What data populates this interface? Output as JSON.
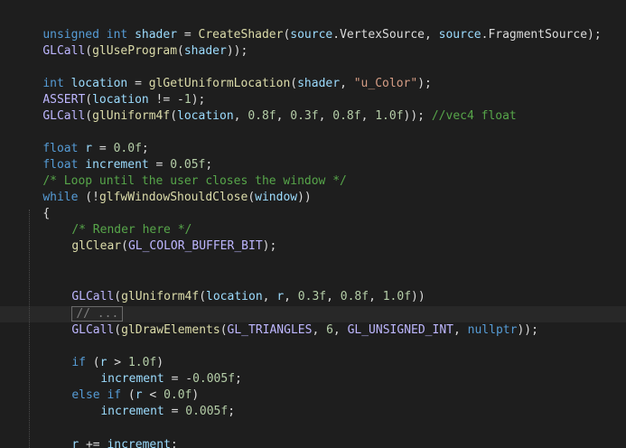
{
  "code": {
    "line1": {
      "t1": "unsigned",
      "t2": " ",
      "t3": "int",
      "t4": " ",
      "t5": "shader",
      "t6": " = ",
      "t7": "CreateShader",
      "t8": "(",
      "t9": "source",
      "t10": ".",
      "t11": "VertexSource",
      "t12": ", ",
      "t13": "source",
      "t14": ".",
      "t15": "FragmentSource",
      "t16": ");"
    },
    "line2": {
      "t1": "GLCall",
      "t2": "(",
      "t3": "glUseProgram",
      "t4": "(",
      "t5": "shader",
      "t6": "));"
    },
    "line4": {
      "t1": "int",
      "t2": " ",
      "t3": "location",
      "t4": " = ",
      "t5": "glGetUniformLocation",
      "t6": "(",
      "t7": "shader",
      "t8": ", ",
      "t9": "\"u_Color\"",
      "t10": ");"
    },
    "line5": {
      "t1": "ASSERT",
      "t2": "(",
      "t3": "location",
      "t4": " != -",
      "t5": "1",
      "t6": ");"
    },
    "line6": {
      "t1": "GLCall",
      "t2": "(",
      "t3": "glUniform4f",
      "t4": "(",
      "t5": "location",
      "t6": ", ",
      "t7": "0.8f",
      "t8": ", ",
      "t9": "0.3f",
      "t10": ", ",
      "t11": "0.8f",
      "t12": ", ",
      "t13": "1.0f",
      "t14": ")); ",
      "t15": "//vec4 float"
    },
    "line8": {
      "t1": "float",
      "t2": " ",
      "t3": "r",
      "t4": " = ",
      "t5": "0.0f",
      "t6": ";"
    },
    "line9": {
      "t1": "float",
      "t2": " ",
      "t3": "increment",
      "t4": " = ",
      "t5": "0.05f",
      "t6": ";"
    },
    "line10": {
      "t1": "/* Loop until the user closes the window */"
    },
    "line11": {
      "t1": "while",
      "t2": " (!",
      "t3": "glfwWindowShouldClose",
      "t4": "(",
      "t5": "window",
      "t6": "))"
    },
    "line12": {
      "t1": "{"
    },
    "line13": {
      "t1": "/* Render here */"
    },
    "line14": {
      "t1": "glClear",
      "t2": "(",
      "t3": "GL_COLOR_BUFFER_BIT",
      "t4": ");"
    },
    "line17": {
      "t1": "GLCall",
      "t2": "(",
      "t3": "glUniform4f",
      "t4": "(",
      "t5": "location",
      "t6": ", ",
      "t7": "r",
      "t8": ", ",
      "t9": "0.3f",
      "t10": ", ",
      "t11": "0.8f",
      "t12": ", ",
      "t13": "1.0f",
      "t14": "))"
    },
    "line18": {
      "t1": "// ..."
    },
    "line19": {
      "t1": "GLCall",
      "t2": "(",
      "t3": "glDrawElements",
      "t4": "(",
      "t5": "GL_TRIANGLES",
      "t6": ", ",
      "t7": "6",
      "t8": ", ",
      "t9": "GL_UNSIGNED_INT",
      "t10": ", ",
      "t11": "nullptr",
      "t12": "));"
    },
    "line21": {
      "t1": "if",
      "t2": " (",
      "t3": "r",
      "t4": " > ",
      "t5": "1.0f",
      "t6": ")"
    },
    "line22": {
      "t1": "increment",
      "t2": " = -",
      "t3": "0.005f",
      "t4": ";"
    },
    "line23": {
      "t1": "else",
      "t2": " ",
      "t3": "if",
      "t4": " (",
      "t5": "r",
      "t6": " < ",
      "t7": "0.0f",
      "t8": ")"
    },
    "line24": {
      "t1": "increment",
      "t2": " = ",
      "t3": "0.005f",
      "t4": ";"
    },
    "line26": {
      "t1": "r",
      "t2": " += ",
      "t3": "increment",
      "t4": ";"
    }
  }
}
